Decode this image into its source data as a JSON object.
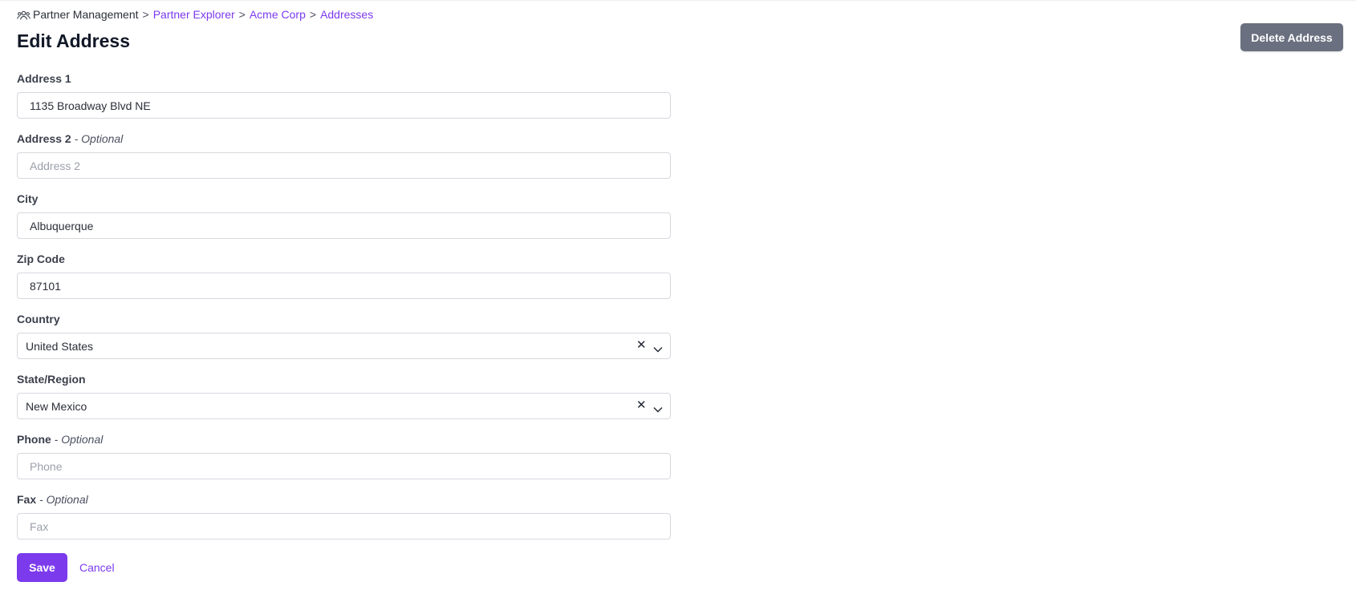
{
  "breadcrumb": {
    "icon": "users-icon",
    "root": "Partner Management",
    "separator": ">",
    "links": [
      "Partner Explorer",
      "Acme Corp",
      "Addresses"
    ]
  },
  "page": {
    "title": "Edit Address",
    "delete_label": "Delete Address"
  },
  "form": {
    "optional_suffix": "- Optional",
    "address1": {
      "label": "Address 1",
      "value": "1135 Broadway Blvd NE",
      "placeholder": ""
    },
    "address2": {
      "label": "Address 2",
      "value": "",
      "placeholder": "Address 2"
    },
    "city": {
      "label": "City",
      "value": "Albuquerque",
      "placeholder": ""
    },
    "zip": {
      "label": "Zip Code",
      "value": "87101",
      "placeholder": ""
    },
    "country": {
      "label": "Country",
      "value": "United States",
      "clear_icon": "close-icon",
      "toggle_icon": "chevron-down-icon"
    },
    "state": {
      "label": "State/Region",
      "value": "New Mexico",
      "clear_icon": "close-icon",
      "toggle_icon": "chevron-down-icon"
    },
    "phone": {
      "label": "Phone",
      "value": "",
      "placeholder": "Phone"
    },
    "fax": {
      "label": "Fax",
      "value": "",
      "placeholder": "Fax"
    }
  },
  "actions": {
    "save_label": "Save",
    "cancel_label": "Cancel"
  },
  "colors": {
    "accent": "#7c3aed",
    "delete_button": "#6b7080",
    "title": "#111827",
    "input_border": "#d6d8de",
    "placeholder": "#9ca0ab"
  }
}
